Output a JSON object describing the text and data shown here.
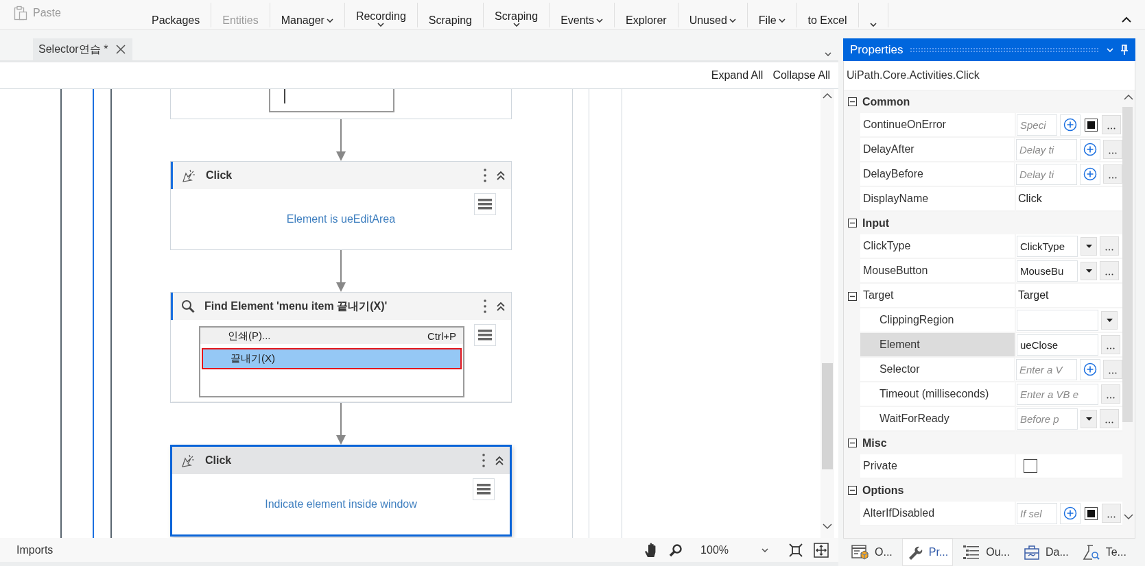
{
  "ribbon": {
    "buttons": [
      {
        "kind": "paste",
        "lines": [
          "Paste"
        ],
        "disabled": true,
        "dropdown": false
      },
      {
        "kind": "plain",
        "lines": [
          "Packages"
        ],
        "disabled": false,
        "dropdown": false
      },
      {
        "kind": "plain",
        "lines": [
          "Entities"
        ],
        "disabled": true,
        "dropdown": false
      },
      {
        "kind": "plain",
        "lines": [
          "Manager"
        ],
        "disabled": false,
        "dropdown": true
      },
      {
        "kind": "stacked",
        "lines": [
          "Recording"
        ],
        "disabled": false,
        "dropdown": true
      },
      {
        "kind": "plain",
        "lines": [
          "Scraping"
        ],
        "disabled": false,
        "dropdown": false
      },
      {
        "kind": "stacked",
        "lines": [
          "Scraping"
        ],
        "disabled": false,
        "dropdown": true
      },
      {
        "kind": "plain",
        "lines": [
          "Events"
        ],
        "disabled": false,
        "dropdown": true
      },
      {
        "kind": "plain",
        "lines": [
          "Explorer"
        ],
        "disabled": false,
        "dropdown": false
      },
      {
        "kind": "plain",
        "lines": [
          "Unused"
        ],
        "disabled": false,
        "dropdown": true
      },
      {
        "kind": "plain",
        "lines": [
          "File"
        ],
        "disabled": false,
        "dropdown": true
      },
      {
        "kind": "plain",
        "lines": [
          "to Excel"
        ],
        "disabled": false,
        "dropdown": false
      },
      {
        "kind": "stacked",
        "disabled": false,
        "dropdown": true
      }
    ]
  },
  "document_tabs": [
    {
      "label": "Selector연습 *",
      "selected": true
    }
  ],
  "designer": {
    "actions": [
      "Expand All",
      "Collapse All"
    ],
    "activities": [
      {
        "kind": "cut"
      },
      {
        "kind": "click",
        "title": "Click",
        "body": "Element is ueEditArea",
        "selected": false
      },
      {
        "kind": "find",
        "title": "Find Element 'menu item  끝내기(X)'",
        "selected": false,
        "preview": [
          {
            "label": "인쇄(P)...",
            "shortcut": "Ctrl+P",
            "selected": false
          },
          {
            "label": "끝내기(X)",
            "selected": true
          }
        ]
      },
      {
        "kind": "click",
        "title": "Click",
        "body": "Indicate element inside window",
        "selected": true
      }
    ]
  },
  "status_bar": {
    "imports": "Imports",
    "zoom": "100%"
  },
  "properties": {
    "title": "Properties",
    "type_name": "UiPath.Core.Activities.Click",
    "groups": [
      {
        "name": "Common",
        "expanded": true,
        "rows": [
          {
            "name": "ContinueOnError",
            "kind": "expression-flag",
            "placeholder": "Speci",
            "checked": true,
            "selected": false
          },
          {
            "name": "DelayAfter",
            "kind": "expression",
            "placeholder": "Delay ti",
            "selected": false
          },
          {
            "name": "DelayBefore",
            "kind": "expression",
            "placeholder": "Delay ti",
            "selected": false
          },
          {
            "name": "DisplayName",
            "kind": "text",
            "value": "Click",
            "selected": false
          }
        ]
      },
      {
        "name": "Input",
        "expanded": true,
        "rows": [
          {
            "name": "ClickType",
            "kind": "enum",
            "value": "ClickType",
            "selected": false
          },
          {
            "name": "MouseButton",
            "kind": "enum",
            "value": "MouseBu",
            "selected": false
          },
          {
            "name": "Target",
            "kind": "group",
            "value": "Target",
            "expanded": true,
            "selected": false,
            "children": [
              {
                "name": "ClippingRegion",
                "kind": "combo",
                "selected": false
              },
              {
                "name": "Element",
                "kind": "input",
                "value": "ueClose",
                "selected": true
              },
              {
                "name": "Selector",
                "kind": "expression",
                "placeholder": "Enter a V",
                "selected": false
              },
              {
                "name": "Timeout (milliseconds)",
                "kind": "input",
                "placeholder": "Enter a VB e",
                "selected": false
              },
              {
                "name": "WaitForReady",
                "kind": "enum",
                "placeholder": "Before p",
                "selected": false
              }
            ]
          }
        ]
      },
      {
        "name": "Misc",
        "expanded": true,
        "rows": [
          {
            "name": "Private",
            "kind": "checkbox",
            "checked": false,
            "selected": false
          }
        ]
      },
      {
        "name": "Options",
        "expanded": true,
        "rows": [
          {
            "name": "AlterIfDisabled",
            "kind": "expression-flag",
            "placeholder": "If sel",
            "checked": true,
            "selected": false
          }
        ]
      }
    ]
  },
  "panel_tabs": [
    {
      "label": "O...",
      "selected": false
    },
    {
      "label": "Pr...",
      "selected": true
    },
    {
      "label": "Ou...",
      "selected": false
    },
    {
      "label": "Da...",
      "selected": false
    },
    {
      "label": "Te...",
      "selected": false
    }
  ]
}
